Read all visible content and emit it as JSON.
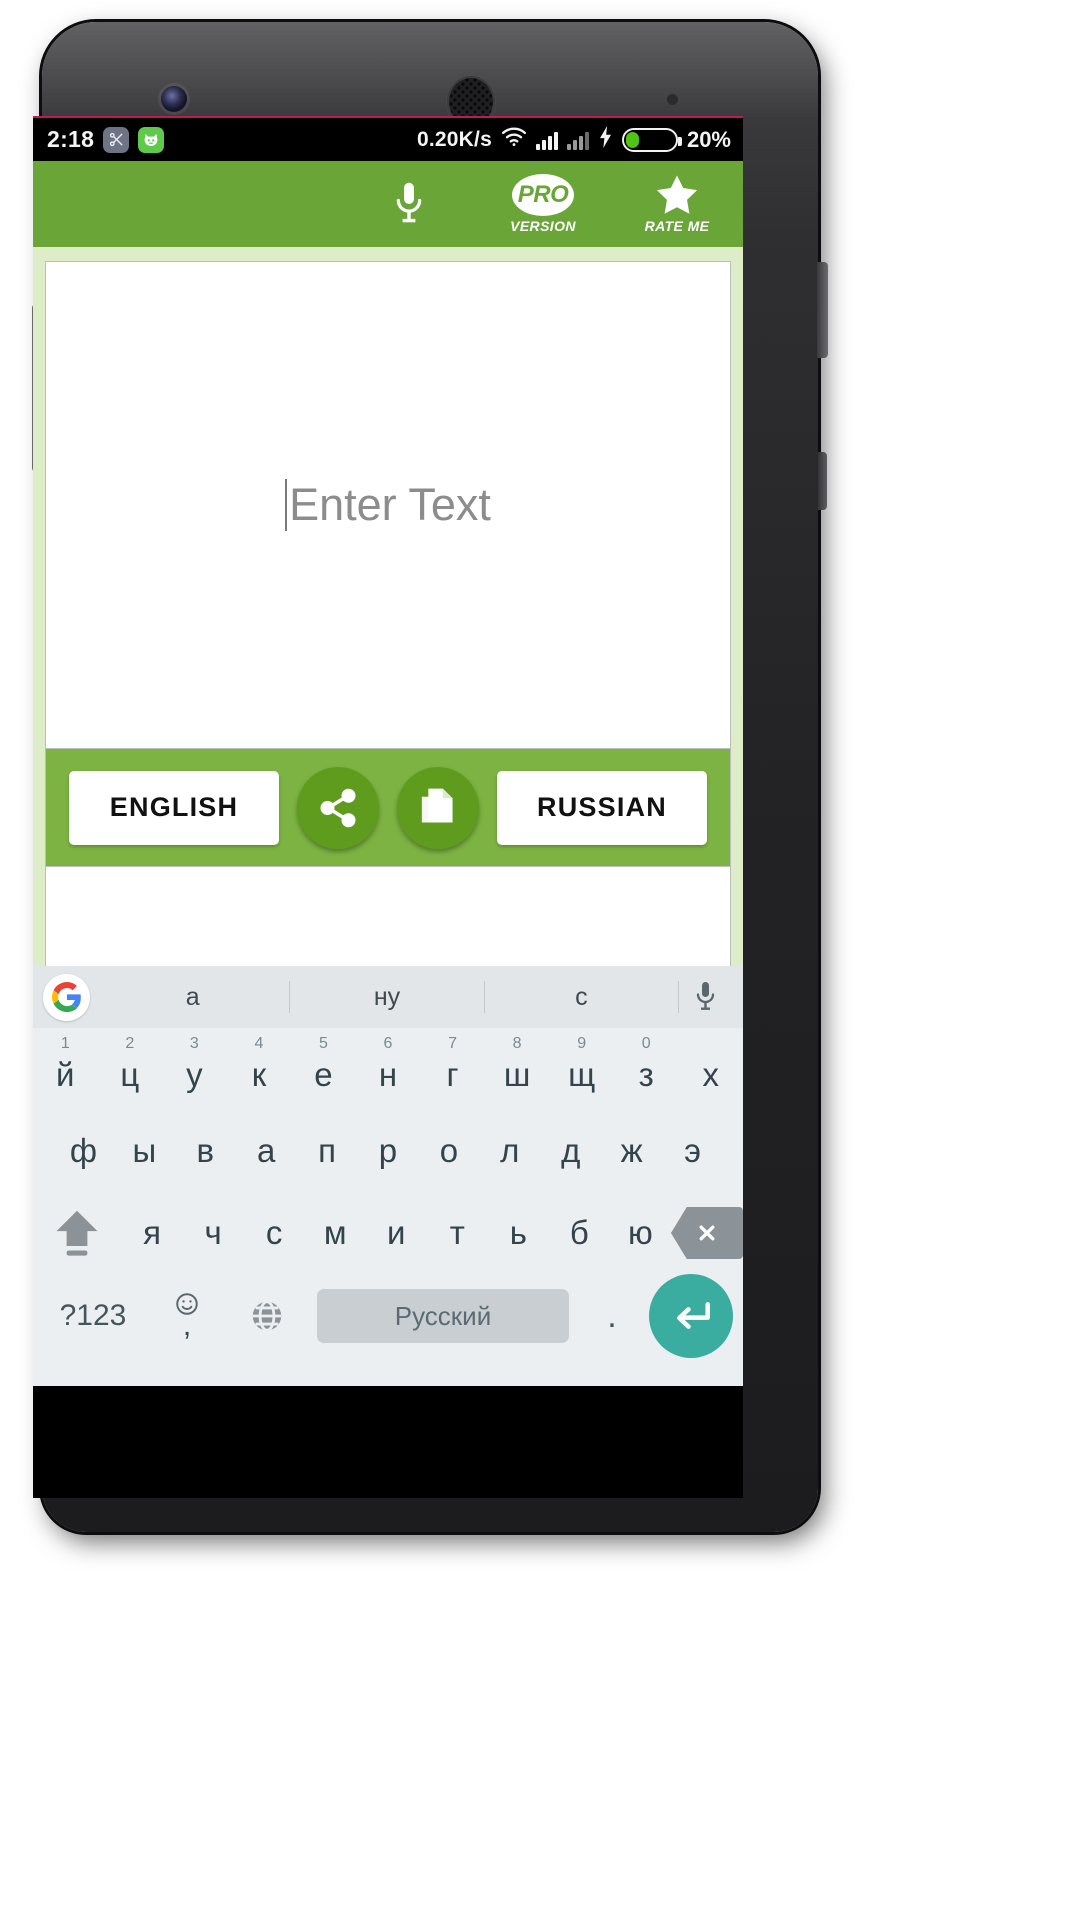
{
  "status_bar": {
    "time": "2:18",
    "icons": [
      "scissors-app-icon",
      "cat-app-icon"
    ],
    "net_speed": "0.20K/s",
    "wifi": "wifi-icon",
    "signal_1": "signal-bars-icon",
    "signal_2": "signal-bars-icon",
    "charging": "charging-bolt-icon",
    "battery_percent": "20%",
    "battery_level": 28,
    "battery_color": "#4fc616",
    "background": "#000000"
  },
  "app_bar": {
    "background": "#6aa637",
    "mic_icon": "microphone-icon",
    "pro": {
      "badge": "PRO",
      "label": "VERSION"
    },
    "rate": {
      "icon": "star-icon",
      "label": "RATE ME"
    }
  },
  "editor": {
    "placeholder": "Enter Text",
    "value": "",
    "background": "#ffffff"
  },
  "language_bar": {
    "background": "#7cb342",
    "source_language": "ENGLISH",
    "target_language": "RUSSIAN",
    "share_icon": "share-icon",
    "copy_icon": "copy-icon"
  },
  "keyboard": {
    "background": "#eceff1",
    "suggestion_bar": {
      "logo": "google-logo-icon",
      "suggestions": [
        "а",
        "ну",
        "с"
      ],
      "mic_icon": "microphone-icon"
    },
    "row1": [
      {
        "key": "й",
        "hint": "1"
      },
      {
        "key": "ц",
        "hint": "2"
      },
      {
        "key": "у",
        "hint": "3"
      },
      {
        "key": "к",
        "hint": "4"
      },
      {
        "key": "е",
        "hint": "5"
      },
      {
        "key": "н",
        "hint": "6"
      },
      {
        "key": "г",
        "hint": "7"
      },
      {
        "key": "ш",
        "hint": "8"
      },
      {
        "key": "щ",
        "hint": "9"
      },
      {
        "key": "з",
        "hint": "0"
      },
      {
        "key": "х",
        "hint": ""
      }
    ],
    "row2": [
      "ф",
      "ы",
      "в",
      "а",
      "п",
      "р",
      "о",
      "л",
      "д",
      "ж",
      "э"
    ],
    "row3": [
      "я",
      "ч",
      "с",
      "м",
      "и",
      "т",
      "ь",
      "б",
      "ю"
    ],
    "shift_icon": "shift-arrow-icon",
    "backspace_icon": "backspace-delete-icon",
    "bottom_row": {
      "symbols_key": "?123",
      "emoji_key": "emoji-comma-icon",
      "globe_key": "globe-language-icon",
      "spacebar_label": "Русский",
      "period_key": ".",
      "enter_icon": "enter-return-icon",
      "enter_color": "#3aada0"
    }
  }
}
